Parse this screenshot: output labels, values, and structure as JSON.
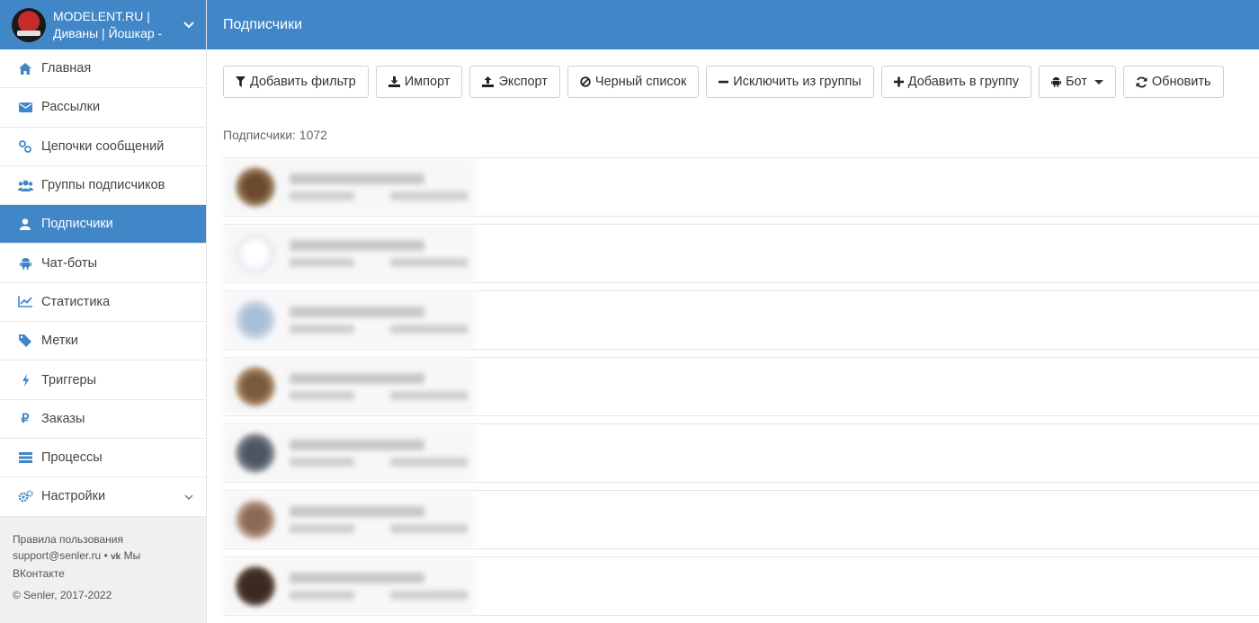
{
  "brand": {
    "title_line1": "MODELENT.RU |",
    "title_line2": "Диваны | Йошкар -"
  },
  "topbar": {
    "title": "Подписчики"
  },
  "menu": [
    {
      "label": "Главная",
      "icon": "home-icon",
      "glyph": "⌂"
    },
    {
      "label": "Рассылки",
      "icon": "envelope-icon",
      "glyph": "✉"
    },
    {
      "label": "Цепочки сообщений",
      "icon": "link-icon",
      "glyph": "⚯"
    },
    {
      "label": "Группы подписчиков",
      "icon": "users-icon",
      "glyph": "👥"
    },
    {
      "label": "Подписчики",
      "icon": "user-icon",
      "glyph": "●",
      "active": true
    },
    {
      "label": "Чат-боты",
      "icon": "android-icon",
      "glyph": "▣"
    },
    {
      "label": "Статистика",
      "icon": "chart-line-icon",
      "glyph": "📈"
    },
    {
      "label": "Метки",
      "icon": "tag-icon",
      "glyph": "◆"
    },
    {
      "label": "Триггеры",
      "icon": "bolt-icon",
      "glyph": "ϟ"
    },
    {
      "label": "Заказы",
      "icon": "ruble-icon",
      "glyph": "₽"
    },
    {
      "label": "Процессы",
      "icon": "tasks-icon",
      "glyph": "≡"
    },
    {
      "label": "Настройки",
      "icon": "cogs-icon",
      "glyph": "⚙",
      "has_arrow": true
    }
  ],
  "footer": {
    "terms": "Правила пользования",
    "support": "support@senler.ru",
    "separator": "•",
    "vk": "Мы ВКонтакте",
    "copyright": "© Senler, 2017-2022"
  },
  "toolbar": {
    "add_filter": "Добавить фильтр",
    "import": "Импорт",
    "export": "Экспорт",
    "blacklist": "Черный список",
    "exclude": "Исключить из группы",
    "add_to_group": "Добавить в группу",
    "bot": "Бот",
    "refresh": "Обновить"
  },
  "count": {
    "label": "Подписчики: 1072"
  },
  "colors": {
    "accent": "#4187c8"
  }
}
